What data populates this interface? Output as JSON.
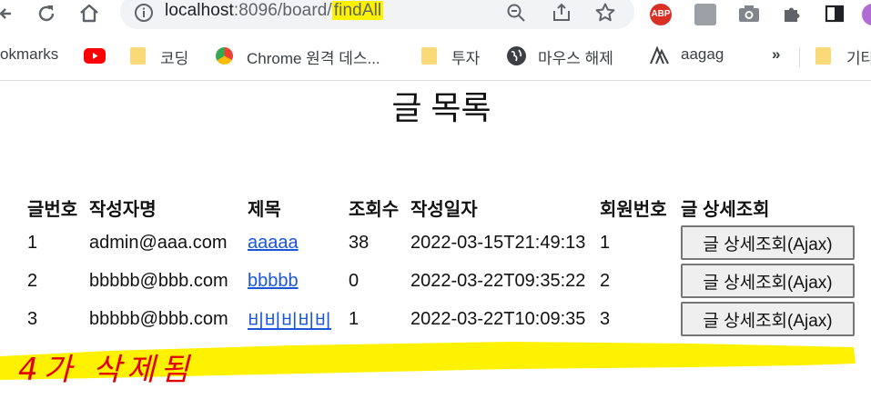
{
  "browser": {
    "url": {
      "host": "localhost",
      "port_path": ":8096/board/",
      "highlighted": "findAll"
    },
    "toolbar_icons": [
      "reload-icon",
      "home-icon",
      "site-info-icon",
      "zoom-icon",
      "share-icon",
      "star-icon"
    ],
    "extensions": [
      "adblock-plus-icon",
      "profile-extension-icon",
      "camera-icon",
      "puzzle-icon",
      "sidebar-icon",
      "profile-avatar-icon"
    ],
    "adblock_label": "ABP",
    "bookmarks": [
      {
        "label": "okmarks",
        "icon": "none"
      },
      {
        "label": "",
        "icon": "youtube-icon"
      },
      {
        "label": "코딩",
        "icon": "folder-icon"
      },
      {
        "label": "Chrome 원격 데스...",
        "icon": "chrome-remote-icon"
      },
      {
        "label": "투자",
        "icon": "folder-icon"
      },
      {
        "label": "마우스 해제",
        "icon": "globe-icon"
      },
      {
        "label": "aagag",
        "icon": "aagag-icon"
      },
      {
        "label": "»",
        "icon": "none"
      },
      {
        "label": "기타",
        "icon": "folder-icon"
      }
    ]
  },
  "page": {
    "title": "글 목록",
    "table": {
      "headers": [
        "글번호",
        "작성자명",
        "제목",
        "조회수",
        "작성일자",
        "회원번호",
        "글 상세조회"
      ],
      "rows": [
        {
          "id": "1",
          "writer": "admin@aaa.com",
          "title": "aaaaa",
          "hits": "38",
          "created": "2022-03-15T21:49:13",
          "member_id": "1",
          "button": "글 상세조회(Ajax)"
        },
        {
          "id": "2",
          "writer": "bbbbb@bbb.com",
          "title": "bbbbb",
          "hits": "0",
          "created": "2022-03-22T09:35:22",
          "member_id": "2",
          "button": "글 상세조회(Ajax)"
        },
        {
          "id": "3",
          "writer": "bbbbb@bbb.com",
          "title": "비비비비비",
          "hits": "1",
          "created": "2022-03-22T10:09:35",
          "member_id": "3",
          "button": "글 상세조회(Ajax)"
        }
      ]
    },
    "annotation": {
      "text": "4가 삭제됨",
      "ink_color": "#e00000",
      "highlight_color": "#fff200"
    }
  }
}
